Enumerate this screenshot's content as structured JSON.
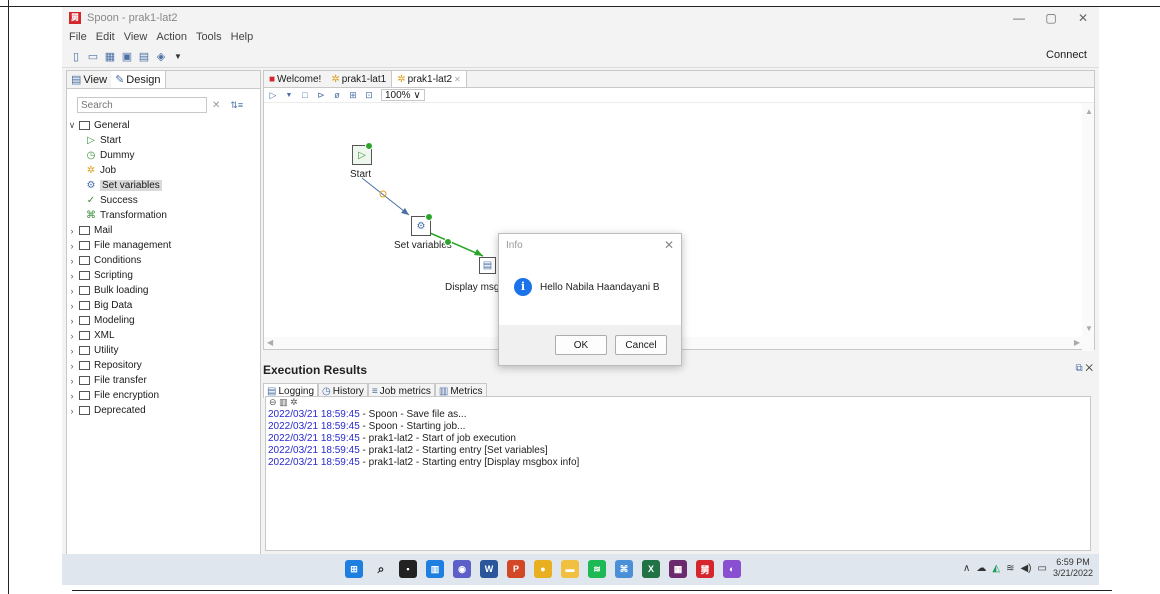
{
  "window": {
    "title": "Spoon - prak1-lat2",
    "logo_text": "舅",
    "minimize": "—",
    "restore": "▢",
    "close": "✕"
  },
  "menu": [
    "File",
    "Edit",
    "View",
    "Action",
    "Tools",
    "Help"
  ],
  "connect_label": "Connect",
  "left_panel": {
    "tabs": [
      "View",
      "Design"
    ],
    "search_placeholder": "Search",
    "general": "General",
    "general_children": [
      "Start",
      "Dummy",
      "Job",
      "Set variables",
      "Success",
      "Transformation"
    ],
    "categories": [
      "Mail",
      "File management",
      "Conditions",
      "Scripting",
      "Bulk loading",
      "Big Data",
      "Modeling",
      "XML",
      "Utility",
      "Repository",
      "File transfer",
      "File encryption",
      "Deprecated"
    ]
  },
  "editor": {
    "tabs": [
      "Welcome!",
      "prak1-lat1",
      "prak1-lat2"
    ],
    "zoom": "100%",
    "nodes": {
      "start": "Start",
      "set_variables": "Set variables",
      "display": "Display msgb"
    }
  },
  "results": {
    "title": "Execution Results",
    "tabs": [
      "Logging",
      "History",
      "Job metrics",
      "Metrics"
    ],
    "logs": [
      {
        "ts": "2022/03/21 18:59:45",
        "msg": " - Spoon - Save file as..."
      },
      {
        "ts": "2022/03/21 18:59:45",
        "msg": " - Spoon - Starting job..."
      },
      {
        "ts": "2022/03/21 18:59:45",
        "msg": " - prak1-lat2 - Start of job execution"
      },
      {
        "ts": "2022/03/21 18:59:45",
        "msg": " - prak1-lat2 - Starting entry [Set variables]"
      },
      {
        "ts": "2022/03/21 18:59:45",
        "msg": " - prak1-lat2 - Starting entry [Display msgbox info]"
      }
    ]
  },
  "dialog": {
    "title": "Info",
    "message": "Hello Nabila Haandayani B",
    "ok": "OK",
    "cancel": "Cancel"
  },
  "taskbar": {
    "time": "6:59 PM",
    "date": "3/21/2022"
  }
}
